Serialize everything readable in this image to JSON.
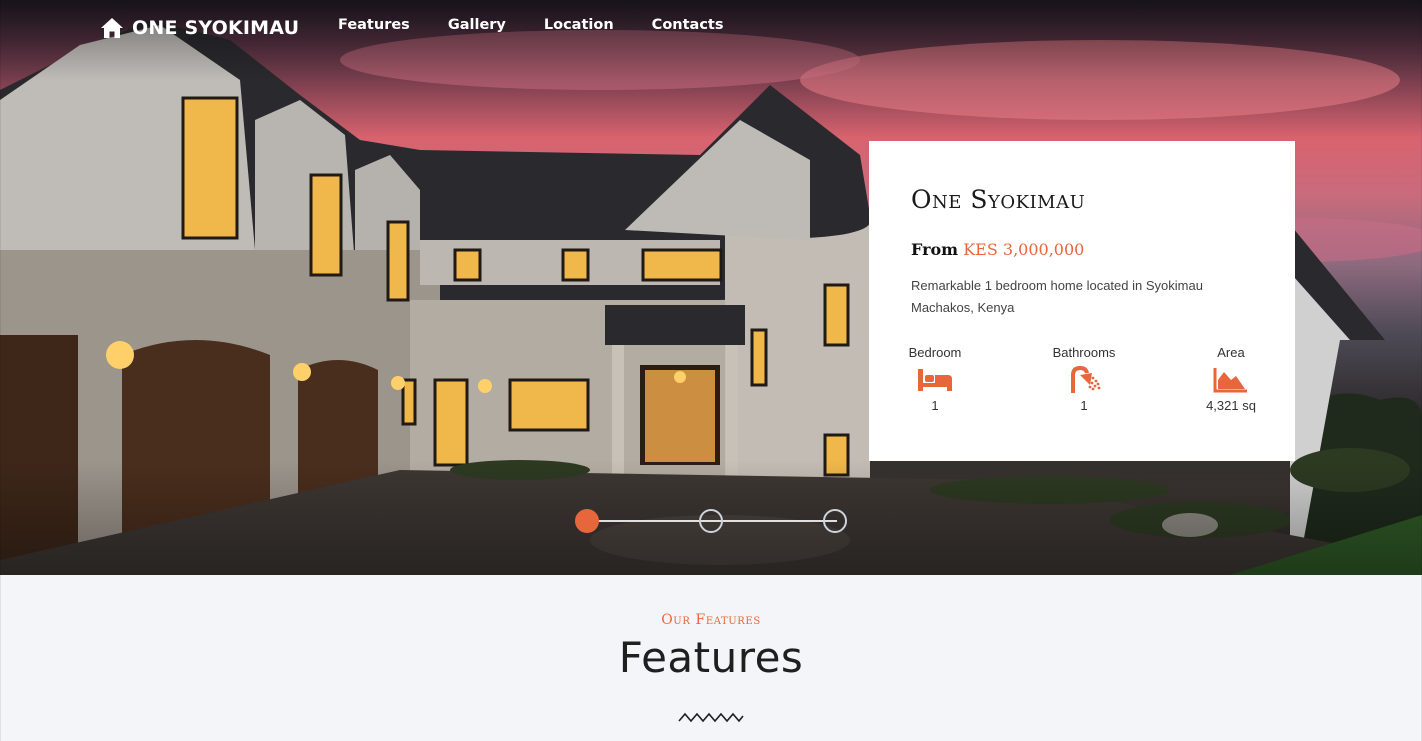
{
  "nav": {
    "brand": "ONE SYOKIMAU",
    "brand_icon": "home-icon",
    "links": [
      "Features",
      "Gallery",
      "Location",
      "Contacts"
    ]
  },
  "hero_card": {
    "title": "One Syokimau",
    "price_prefix": "From",
    "price": "KES 3,000,000",
    "description": "Remarkable 1 bedroom home located in Syokimau Machakos, Kenya",
    "specs": [
      {
        "label": "Bedroom",
        "icon": "bed-icon",
        "value": "1"
      },
      {
        "label": "Bathrooms",
        "icon": "shower-icon",
        "value": "1"
      },
      {
        "label": "Area",
        "icon": "area-chart-icon",
        "value": "4,321 sq"
      }
    ]
  },
  "slider": {
    "slides": 3,
    "active_index": 0
  },
  "features": {
    "eyebrow": "Our Features",
    "title": "Features",
    "divider_icon": "zigzag-icon"
  },
  "colors": {
    "accent": "#e8663b",
    "card_bg": "#ffffff",
    "section_bg": "#f4f5f8",
    "nav_text": "#ffffff"
  }
}
